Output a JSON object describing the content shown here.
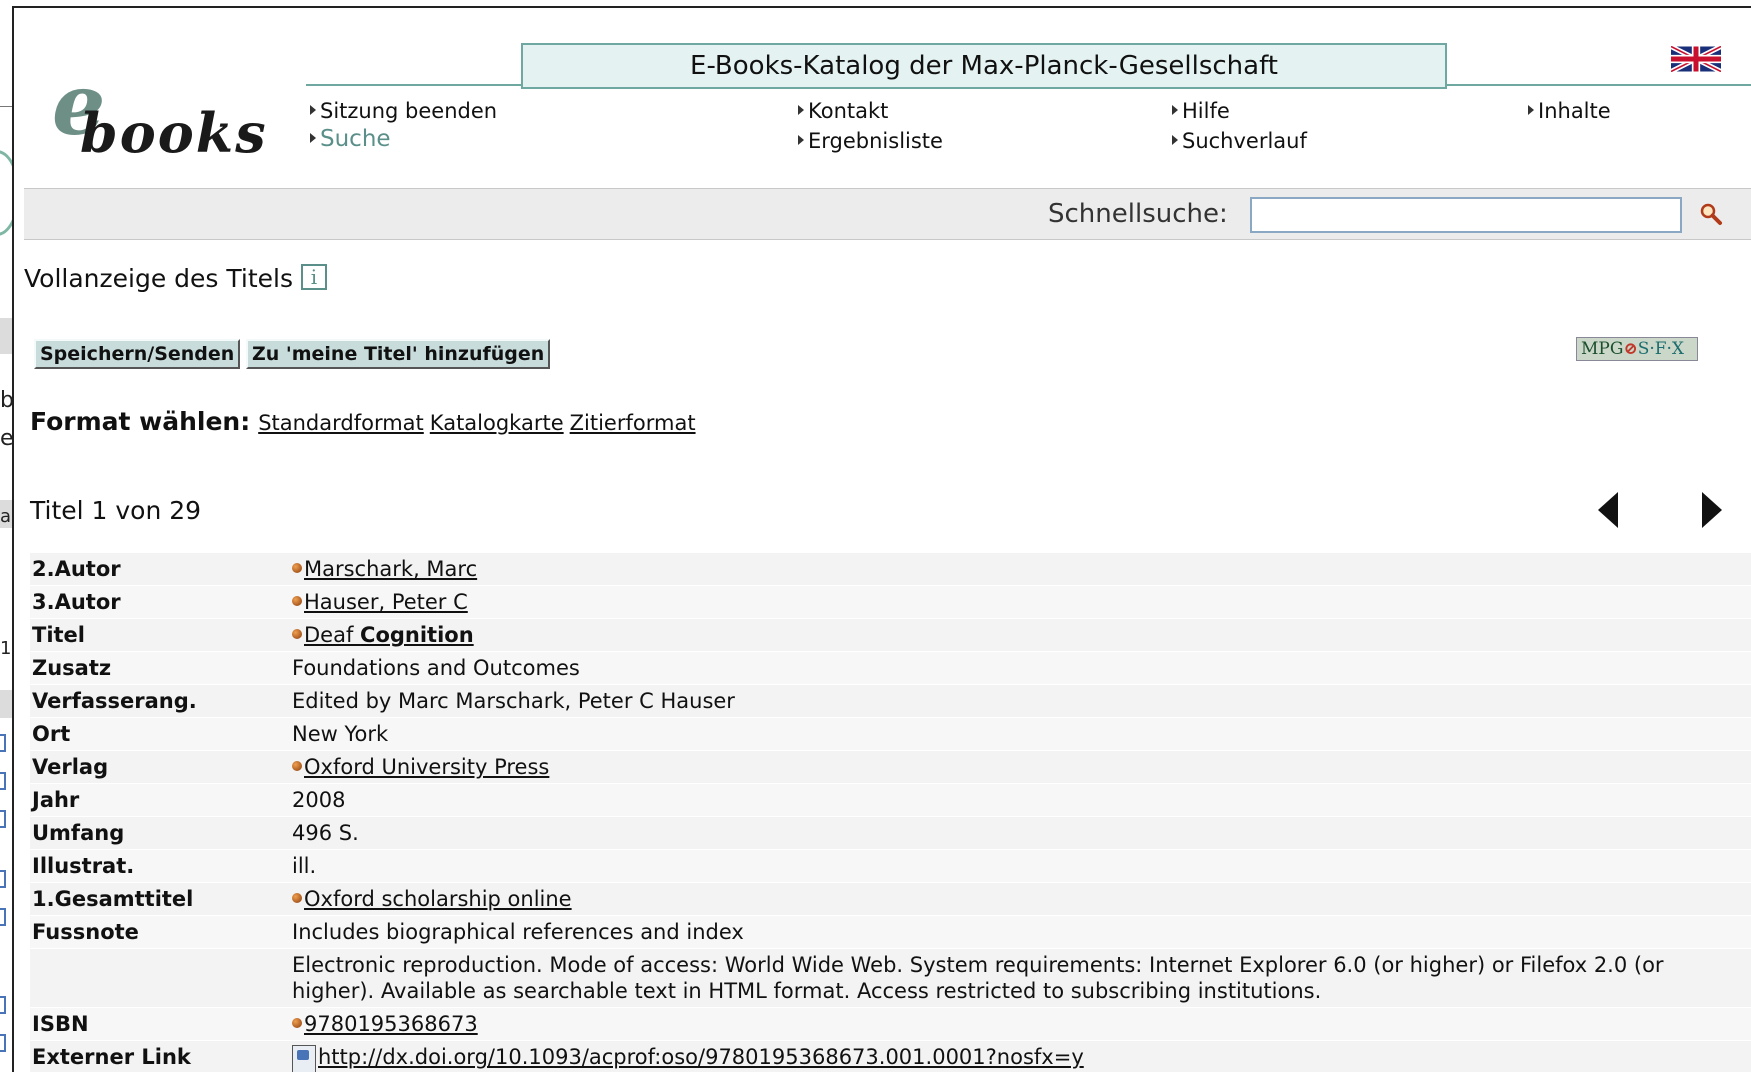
{
  "app": {
    "logo_e": "e",
    "logo_books": "books",
    "title": "E-Books-Katalog der Max-Planck-Gesellschaft"
  },
  "nav": {
    "sitzung_beenden": "Sitzung beenden",
    "suche": "Suche",
    "kontakt": "Kontakt",
    "ergebnisliste": "Ergebnisliste",
    "hilfe": "Hilfe",
    "suchverlauf": "Suchverlauf",
    "inhalte": "Inhalte"
  },
  "quicksearch": {
    "label": "Schnellsuche:",
    "value": ""
  },
  "page": {
    "title": "Vollanzeige des Titels",
    "info_glyph": "i"
  },
  "actions": {
    "save_send": "Speichern/Senden",
    "add_mine": "Zu 'meine Titel' hinzufügen"
  },
  "sfx": {
    "mpg": "MPG",
    "sfx": "S·F·X"
  },
  "format": {
    "label": "Format wählen:",
    "options": [
      "Standardformat",
      "Katalogkarte",
      "Zitierformat"
    ]
  },
  "record": {
    "counter": "Titel 1 von 29",
    "fields": {
      "autor2": {
        "label": "2.Autor",
        "value": "Marschark, Marc "
      },
      "autor3": {
        "label": "3.Autor",
        "value": "Hauser, Peter C "
      },
      "titel": {
        "label": "Titel",
        "value_a": "Deaf ",
        "value_b": "Cognition"
      },
      "zusatz": {
        "label": "Zusatz",
        "value": "Foundations and Outcomes"
      },
      "verfasserang": {
        "label": "Verfasserang.",
        "value": "Edited by Marc Marschark, Peter C Hauser"
      },
      "ort": {
        "label": "Ort",
        "value": "New York"
      },
      "verlag": {
        "label": "Verlag",
        "value": "Oxford University Press"
      },
      "jahr": {
        "label": "Jahr",
        "value": "2008"
      },
      "umfang": {
        "label": "Umfang",
        "value": "496 S."
      },
      "illustrat": {
        "label": "Illustrat.",
        "value": "ill."
      },
      "gesamttitel": {
        "label": "1.Gesamttitel",
        "value": "Oxford scholarship online"
      },
      "fussnote": {
        "label": "Fussnote",
        "value": "Includes biographical references and index"
      },
      "fussnote2": {
        "label": "",
        "value": "Electronic reproduction. Mode of access: World Wide Web. System requirements: Internet Explorer 6.0 (or higher) or Filefox 2.0 (or higher). Available as searchable text in HTML format. Access restricted to subscribing institutions."
      },
      "isbn": {
        "label": "ISBN",
        "value": "9780195368673"
      },
      "link": {
        "label": "Externer Link",
        "value": "http://dx.doi.org/10.1093/acprof:oso/9780195368673.001.0001?nosfx=y "
      }
    }
  },
  "background_window": {
    "chars": [
      "b",
      "e",
      "a",
      "1"
    ]
  }
}
